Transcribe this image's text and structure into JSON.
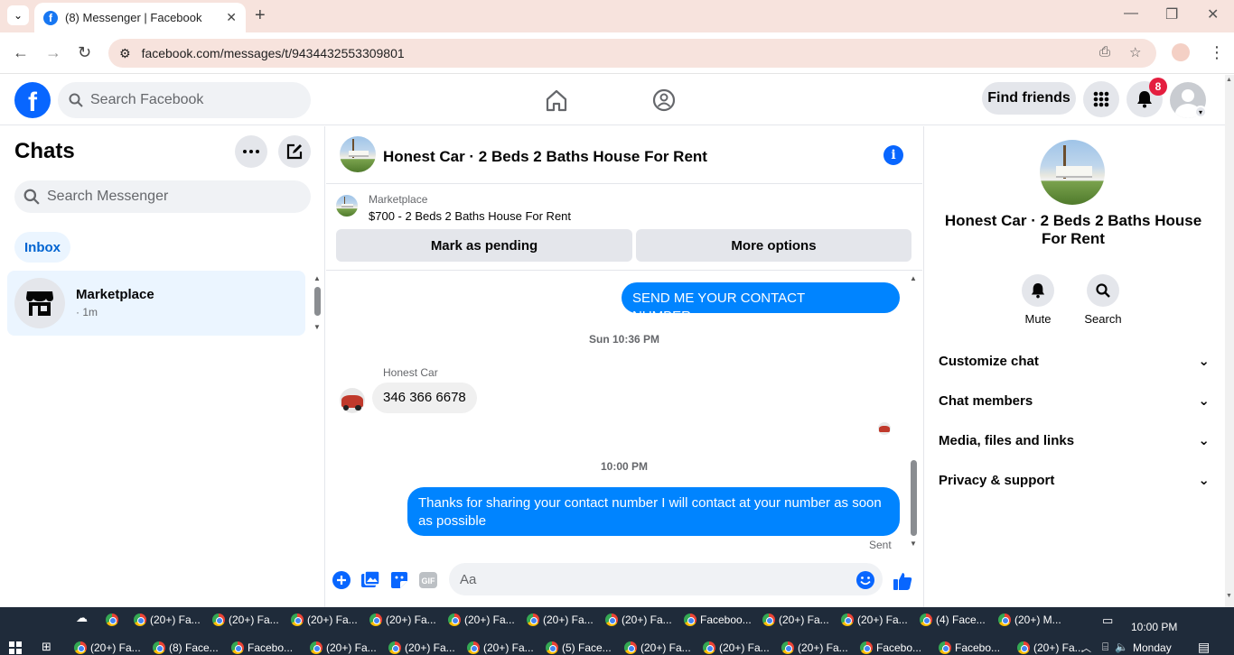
{
  "browser": {
    "tab_title": "(8) Messenger | Facebook",
    "url": "facebook.com/messages/t/9434432553309801"
  },
  "fb": {
    "search_placeholder": "Search Facebook",
    "find_friends": "Find friends",
    "notification_count": "8"
  },
  "left": {
    "title": "Chats",
    "search_placeholder": "Search Messenger",
    "inbox": "Inbox",
    "conversation": {
      "name": "Marketplace",
      "time": "· 1m"
    }
  },
  "thread": {
    "title": "Honest Car · 2 Beds 2 Baths House For Rent",
    "marketplace_label": "Marketplace",
    "listing": "$700 - 2 Beds 2 Baths House For Rent",
    "mark_pending": "Mark as pending",
    "more_options": "More options",
    "messages": [
      {
        "dir": "out",
        "text": "SEND ME YOUR CONTACT NUMBER............."
      },
      {
        "type": "time",
        "text": "Sun 10:36 PM"
      },
      {
        "dir": "in",
        "sender": "Honest Car",
        "text": "346 366 6678"
      },
      {
        "type": "time",
        "text": "10:00 PM"
      },
      {
        "dir": "out",
        "text": "Thanks for sharing your contact number I will contact at your number as soon as possible"
      }
    ],
    "status": "Sent",
    "composer_placeholder": "Aa"
  },
  "right": {
    "name": "Honest Car · 2 Beds 2 Baths House For Rent",
    "mute": "Mute",
    "search": "Search",
    "sections": [
      "Customize chat",
      "Chat members",
      "Media, files and links",
      "Privacy & support"
    ]
  },
  "taskbar": {
    "row1": [
      "(20+) Fa...",
      "(20+) Fa...",
      "(20+) Fa...",
      "(20+) Fa...",
      "(20+) Fa...",
      "(20+) Fa...",
      "(20+) Fa...",
      "Faceboo...",
      "(20+) Fa...",
      "(20+) Fa...",
      "(4) Face...",
      "(20+) M..."
    ],
    "row2": [
      "(20+) Fa...",
      "(8) Face...",
      "Facebo...",
      "(20+) Fa...",
      "(20+) Fa...",
      "(20+) Fa...",
      "(5) Face...",
      "(20+) Fa...",
      "(20+) Fa...",
      "(20+) Fa...",
      "Facebo...",
      "Facebo...",
      "(20+) Fa..."
    ],
    "time": "10:00 PM",
    "day": "Monday"
  },
  "colors": {
    "fb_blue": "#0866ff",
    "bubble_blue": "#0084ff",
    "tab_bg": "#f7e3dd",
    "taskbar": "#1f2b3a"
  }
}
